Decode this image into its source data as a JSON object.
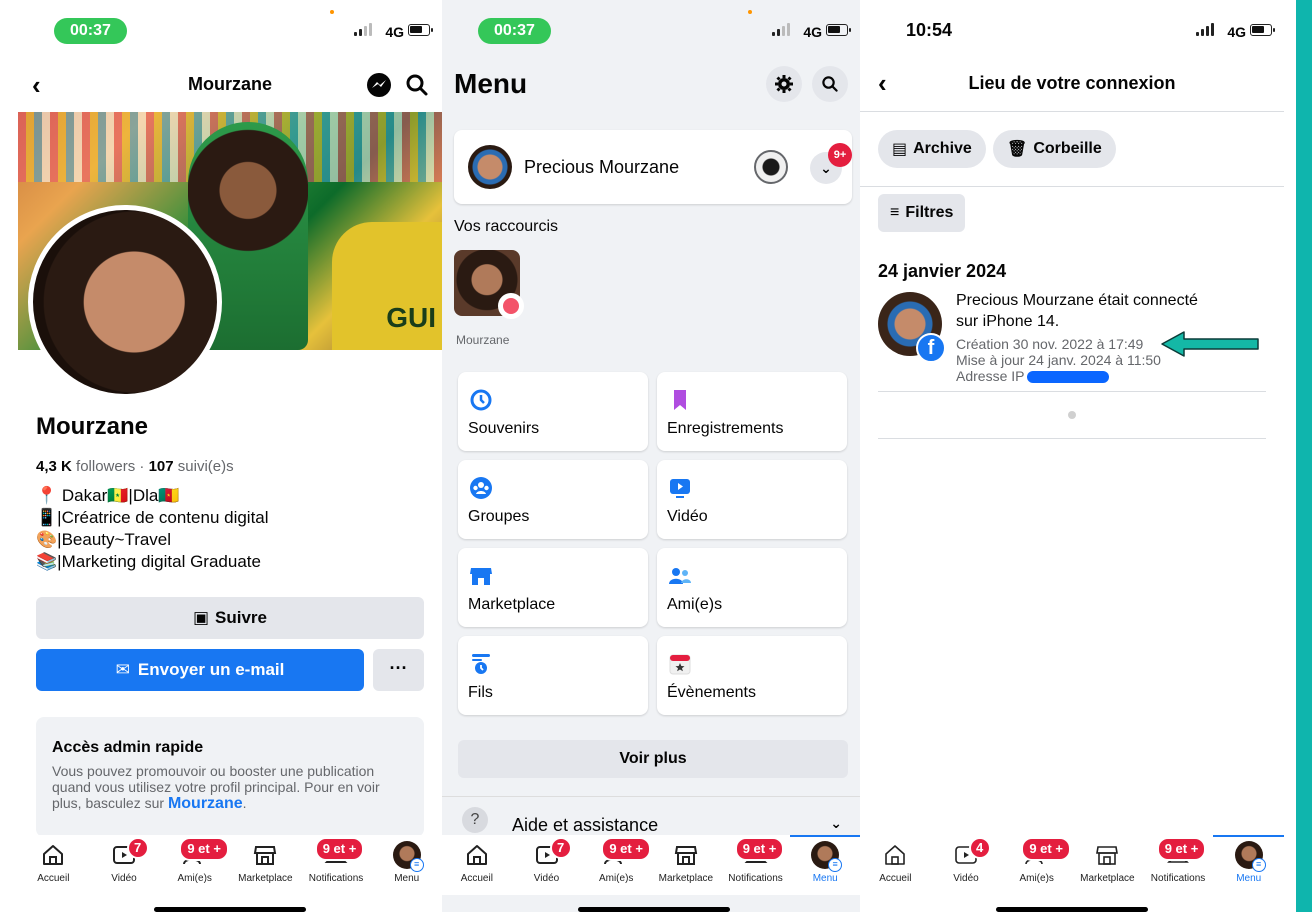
{
  "phone1": {
    "time": "00:37",
    "network": "4G",
    "header_title": "Mourzane",
    "profile_name": "Mourzane",
    "followers_count": "4,3 K",
    "followers_label": "followers",
    "following_count": "107",
    "following_label": "suivi(e)s",
    "stats_separator": "·",
    "bio": [
      "📍 Dakar🇸🇳|Dla🇨🇲",
      "📱|Créatrice de contenu digital",
      "🎨|Beauty~Travel",
      "📚|Marketing digital Graduate"
    ],
    "cover_text": "GUI",
    "follow_button": "Suivre",
    "email_button": "Envoyer un e-mail",
    "more_button": "···",
    "admin_title": "Accès admin rapide",
    "admin_text": "Vous pouvez promouvoir ou booster une publication quand vous utilisez votre profil principal. Pour en voir plus, basculez sur",
    "admin_link": "Mourzane",
    "admin_end": "."
  },
  "phone2": {
    "time": "00:37",
    "network": "4G",
    "menu_title": "Menu",
    "profile_name": "Precious Mourzane",
    "profile_badge": "9+",
    "shortcuts_label": "Vos raccourcis",
    "shortcut_name": "Mourzane",
    "grid": [
      {
        "label": "Souvenirs",
        "icon": "clock-icon"
      },
      {
        "label": "Enregistrements",
        "icon": "bookmark-icon"
      },
      {
        "label": "Groupes",
        "icon": "groups-icon"
      },
      {
        "label": "Vidéo",
        "icon": "video-icon"
      },
      {
        "label": "Marketplace",
        "icon": "shop-icon"
      },
      {
        "label": "Ami(e)s",
        "icon": "friends-icon"
      },
      {
        "label": "Fils",
        "icon": "feeds-icon"
      },
      {
        "label": "Évènements",
        "icon": "calendar-icon"
      }
    ],
    "see_more": "Voir plus",
    "help": "Aide et assistance"
  },
  "phone3": {
    "time": "10:54",
    "network": "4G",
    "header_title": "Lieu de votre connexion",
    "archive": "Archive",
    "trash": "Corbeille",
    "filters": "Filtres",
    "date_heading": "24 janvier 2024",
    "activity_line1": "Precious Mourzane était connecté",
    "activity_line2": "sur iPhone 14.",
    "created": "Création 30 nov. 2022 à 17:49",
    "updated": "Mise à jour 24 janv. 2024 à 11:50",
    "ip_label": "Adresse IP"
  },
  "tabbar_p1": {
    "tabs": [
      {
        "label": "Accueil"
      },
      {
        "label": "Vidéo",
        "badge": "7"
      },
      {
        "label": "Ami(e)s",
        "badge": "9 et +"
      },
      {
        "label": "Marketplace"
      },
      {
        "label": "Notifications",
        "badge": "9 et +"
      },
      {
        "label": "Menu"
      }
    ]
  },
  "tabbar_p3": {
    "video_badge": "4"
  },
  "colors": {
    "fb_blue": "#1877f2",
    "badge_red": "#e41e3f",
    "status_green": "#34c759",
    "arrow_teal": "#14b8a6"
  }
}
